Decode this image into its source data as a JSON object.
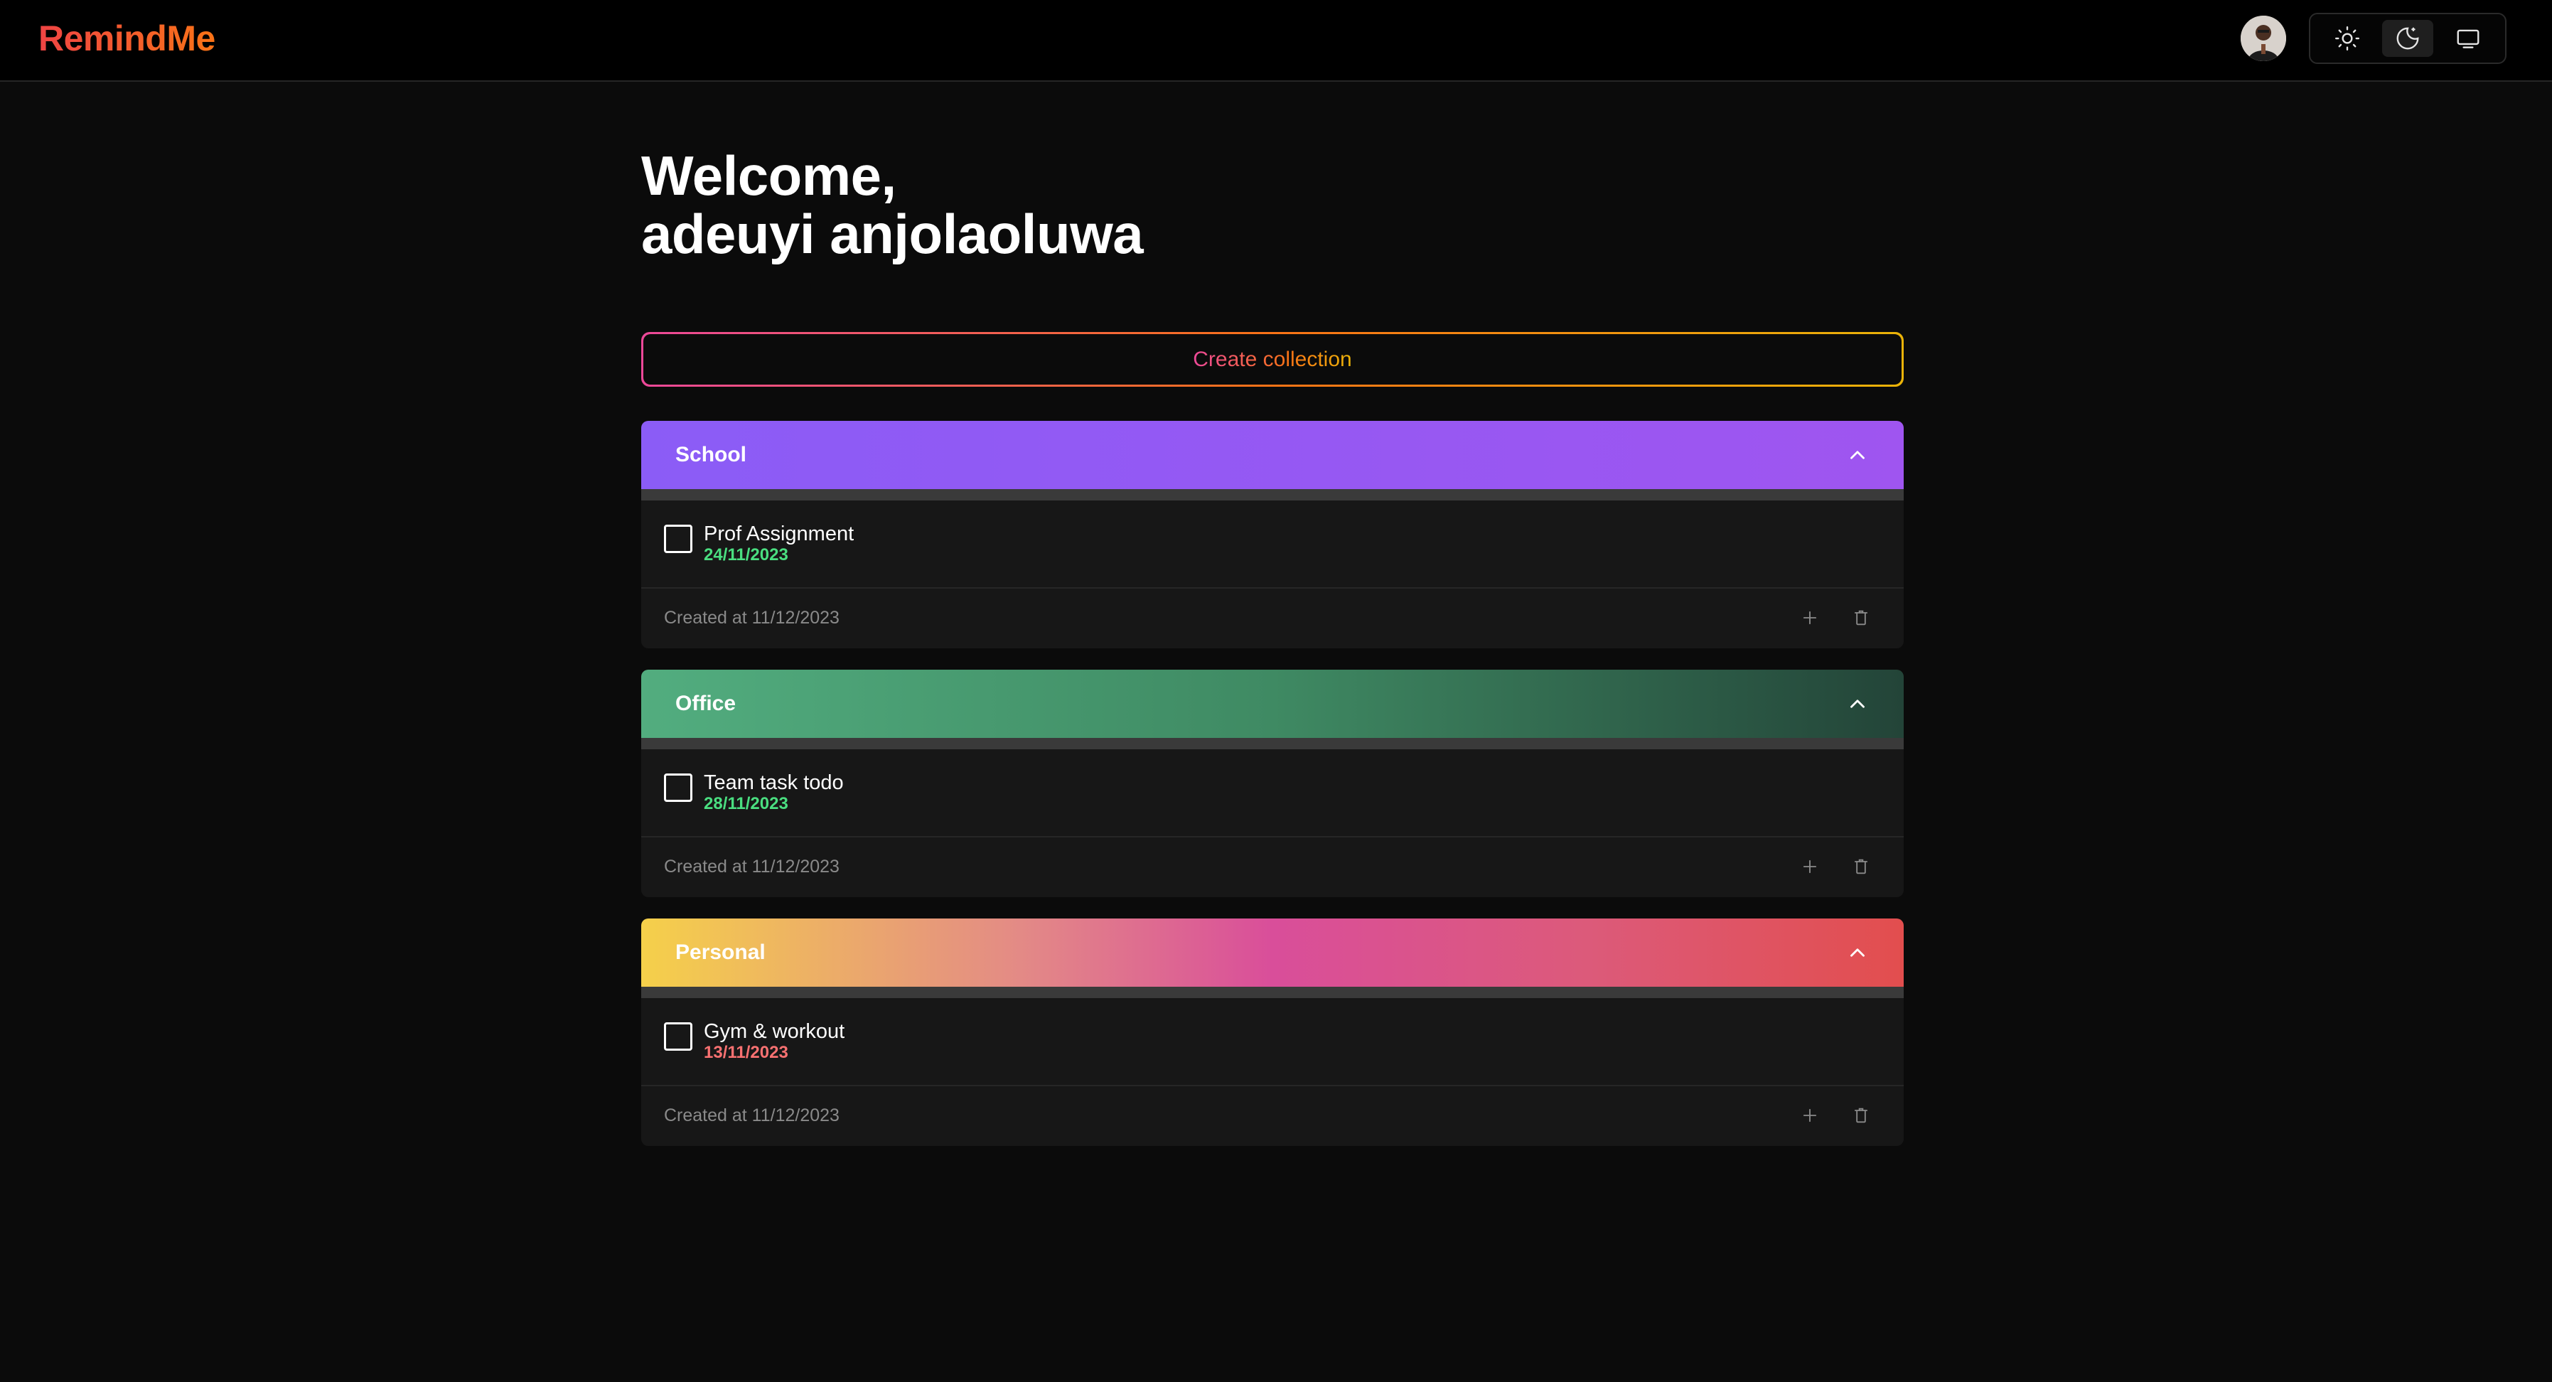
{
  "app": {
    "brand": "RemindMe",
    "brand_gradient": [
      "#ef4444",
      "#f97316"
    ]
  },
  "header": {
    "avatar_icon": "user-avatar",
    "theme_options": [
      {
        "name": "light",
        "icon": "sun-icon",
        "active": false
      },
      {
        "name": "dark",
        "icon": "moon-icon",
        "active": true
      },
      {
        "name": "system",
        "icon": "desktop-icon",
        "active": false
      }
    ]
  },
  "main": {
    "welcome_line1": "Welcome,",
    "welcome_line2": "adeuyi anjolaoluwa",
    "create_collection_label": "Create collection",
    "collections": [
      {
        "title": "School",
        "gradient": [
          "#8b5cf6",
          "#9f55f0"
        ],
        "tasks": [
          {
            "title": "Prof Assignment",
            "date": "24/11/2023",
            "date_color": "#4ade80",
            "checked": false
          }
        ],
        "created": "Created at 11/12/2023"
      },
      {
        "title": "Office",
        "gradient": [
          "#52ad7f",
          "#234438"
        ],
        "tasks": [
          {
            "title": "Team task todo",
            "date": "28/11/2023",
            "date_color": "#4ade80",
            "checked": false
          }
        ],
        "created": "Created at 11/12/2023"
      },
      {
        "title": "Personal",
        "gradient": [
          "#f5d04a",
          "#d94e9a",
          "#e24e4e"
        ],
        "tasks": [
          {
            "title": "Gym & workout",
            "date": "13/11/2023",
            "date_color": "#f87171",
            "checked": false
          }
        ],
        "created": "Created at 11/12/2023"
      }
    ]
  }
}
